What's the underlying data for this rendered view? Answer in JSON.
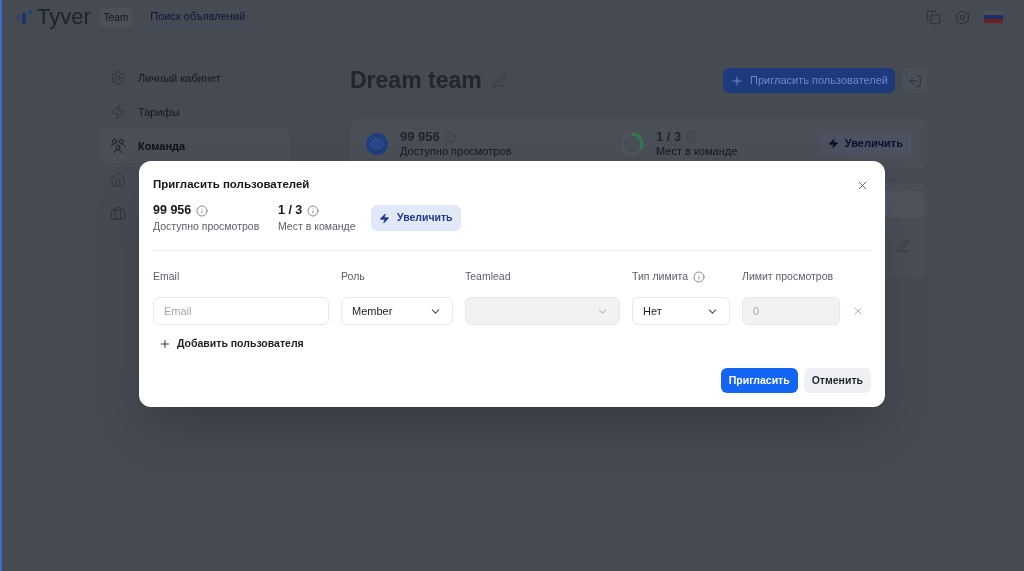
{
  "header": {
    "logo": "Tyver",
    "badge": "Team",
    "link": "Поиск объявлений"
  },
  "sidebar": {
    "items": [
      {
        "label": "Личный кабинет",
        "selected": false
      },
      {
        "label": "Тарифы",
        "selected": false
      },
      {
        "label": "Команда",
        "selected": true
      },
      {
        "selected": false
      },
      {
        "selected": false
      }
    ]
  },
  "page": {
    "title": "Dream team",
    "invite_button": "Пригласить пользователей",
    "stats": [
      {
        "kind": "views",
        "value": "99 956",
        "label": "Доступно просмотров"
      },
      {
        "kind": "seats",
        "value": "1 / 3",
        "label": "Мест в команде",
        "level": 0.33
      }
    ],
    "increase_button": "Увеличить"
  },
  "modal": {
    "title": "Пригласить пользователей",
    "stats": [
      {
        "value": "99 956",
        "label": "Доступно просмотров"
      },
      {
        "value": "1 / 3",
        "label": "Мест в команде"
      }
    ],
    "increase_button": "Увеличить",
    "columns": [
      {
        "label": "Email",
        "info": false
      },
      {
        "label": "Роль",
        "info": false
      },
      {
        "label": "Teamlead",
        "info": false
      },
      {
        "label": "Тип лимита",
        "info": true
      },
      {
        "label": "Лимит просмотров",
        "info": false
      }
    ],
    "rows": [
      {
        "fields": [
          {
            "kind": "text",
            "placeholder": "Email",
            "disabled": false
          },
          {
            "kind": "select",
            "value": "Member",
            "disabled": false
          },
          {
            "kind": "select",
            "disabled": true
          },
          {
            "kind": "select",
            "value": "Нет",
            "disabled": false
          },
          {
            "kind": "text",
            "placeholder": "0",
            "disabled": true
          }
        ]
      }
    ],
    "add_user": "Добавить пользователя",
    "buttons": [
      {
        "label": "Пригласить",
        "kind": "primary"
      },
      {
        "label": "Отменить",
        "kind": "secondary"
      }
    ]
  }
}
